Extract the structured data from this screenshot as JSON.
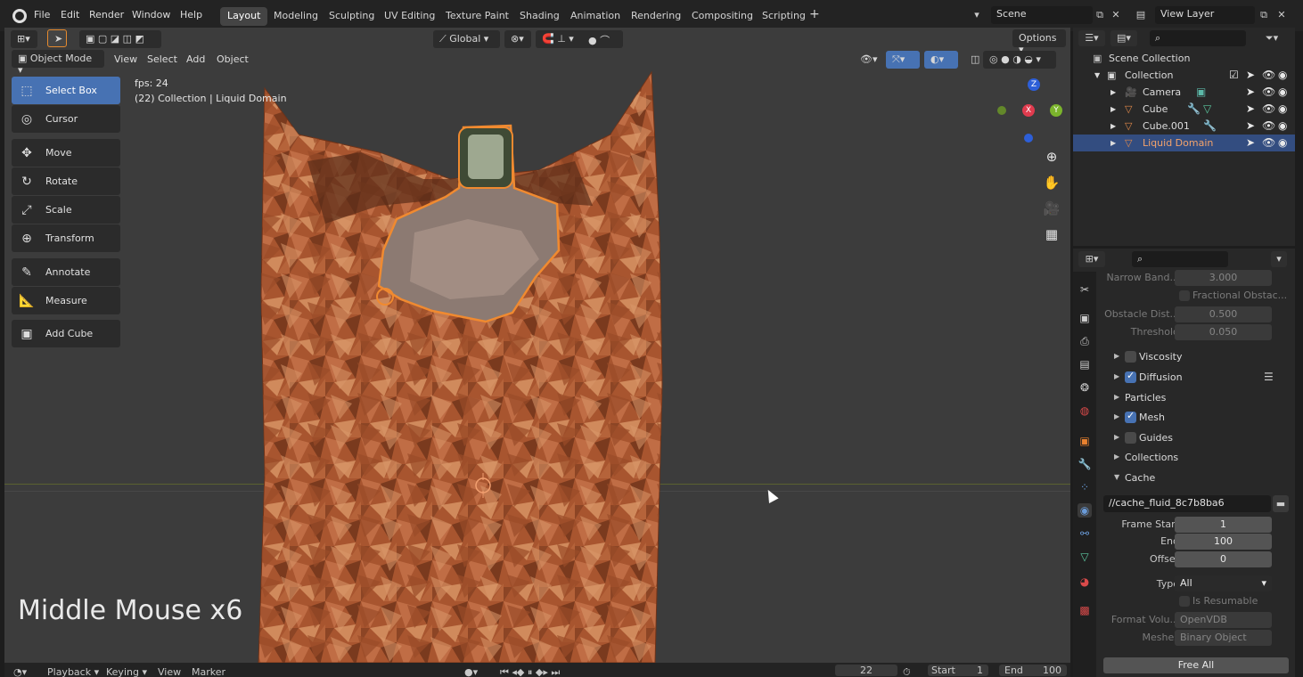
{
  "menubar": {
    "items": [
      "File",
      "Edit",
      "Render",
      "Window",
      "Help"
    ],
    "workspaces": [
      "Layout",
      "Modeling",
      "Sculpting",
      "UV Editing",
      "Texture Paint",
      "Shading",
      "Animation",
      "Rendering",
      "Compositing",
      "Scripting"
    ],
    "active_workspace": "Layout",
    "add_tab": "+",
    "scene": "Scene",
    "view_layer": "View Layer"
  },
  "viewport_header": {
    "mode": "Object Mode",
    "menus": [
      "View",
      "Select",
      "Add",
      "Object"
    ],
    "orientation": "Global",
    "options": "Options"
  },
  "viewport_overlay": {
    "fps": "fps: 24",
    "info": "(22) Collection | Liquid Domain",
    "keystroke": "Middle Mouse x6"
  },
  "gizmo": {
    "z": "Z",
    "x": "X",
    "y": "Y"
  },
  "toolbar": {
    "tools": [
      {
        "label": "Select Box",
        "icon": "select-box-icon",
        "glyph": "⬚"
      },
      {
        "label": "Cursor",
        "icon": "cursor-icon",
        "glyph": "◎"
      },
      {
        "label": "Move",
        "icon": "move-icon",
        "glyph": "✥"
      },
      {
        "label": "Rotate",
        "icon": "rotate-icon",
        "glyph": "↻"
      },
      {
        "label": "Scale",
        "icon": "scale-icon",
        "glyph": "⤢"
      },
      {
        "label": "Transform",
        "icon": "transform-icon",
        "glyph": "⊕"
      },
      {
        "label": "Annotate",
        "icon": "annotate-icon",
        "glyph": "✎"
      },
      {
        "label": "Measure",
        "icon": "measure-icon",
        "glyph": "📐"
      },
      {
        "label": "Add Cube",
        "icon": "add-cube-icon",
        "glyph": "▣"
      }
    ],
    "active": "Select Box"
  },
  "outliner": {
    "root": "Scene Collection",
    "collection": "Collection",
    "objects": [
      "Camera",
      "Cube",
      "Cube.001",
      "Liquid Domain"
    ],
    "selected": "Liquid Domain"
  },
  "properties": {
    "fields": {
      "narrow_band": {
        "label": "Narrow Band...",
        "value": "3.000"
      },
      "fractional": "Fractional Obstac...",
      "obstacle_dist": {
        "label": "Obstacle Dist...",
        "value": "0.500"
      },
      "threshold": {
        "label": "Threshold",
        "value": "0.050"
      }
    },
    "panels": [
      {
        "label": "Viscosity",
        "checkbox": true,
        "checked": false
      },
      {
        "label": "Diffusion",
        "checkbox": true,
        "checked": true
      },
      {
        "label": "Particles",
        "checkbox": false,
        "checked": false
      },
      {
        "label": "Mesh",
        "checkbox": true,
        "checked": true
      },
      {
        "label": "Guides",
        "checkbox": true,
        "checked": false
      },
      {
        "label": "Collections",
        "checkbox": false,
        "checked": false
      },
      {
        "label": "Cache",
        "checkbox": false,
        "checked": false
      }
    ],
    "cache": {
      "path": "//cache_fluid_8c7b8ba6",
      "frame_start_label": "Frame Start",
      "frame_start": "1",
      "end_label": "End",
      "end": "100",
      "offset_label": "Offset",
      "offset": "0",
      "type_label": "Type",
      "type": "All",
      "resumable": "Is Resumable",
      "format_label": "Format Volu...",
      "format": "OpenVDB",
      "meshes_label": "Meshes",
      "meshes": "Binary Object",
      "free_all": "Free All"
    }
  },
  "timeline": {
    "playback": "Playback",
    "keying": "Keying",
    "view": "View",
    "marker": "Marker",
    "current_frame": "22",
    "start_label": "Start",
    "start": "1",
    "end_label": "End",
    "end": "100"
  },
  "colors": {
    "accent": "#4772b3",
    "domain": "#a8552f",
    "selection_outline": "#f08a30"
  }
}
